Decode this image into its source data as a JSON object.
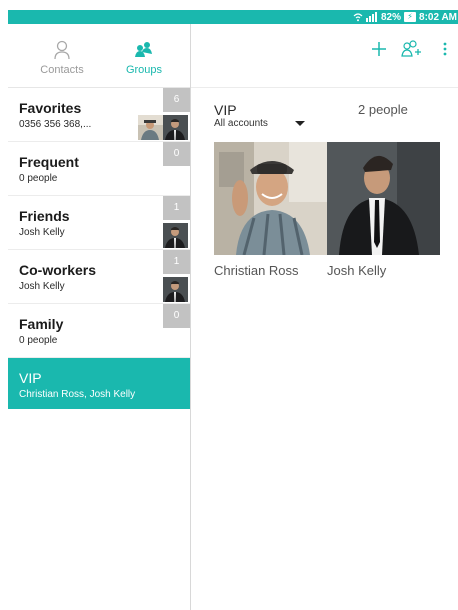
{
  "status_bar": {
    "battery": "82%",
    "time": "8:02 AM",
    "color": "#1ab8ae"
  },
  "tabs": [
    {
      "label": "Contacts",
      "icon": "person-icon",
      "active": false
    },
    {
      "label": "Groups",
      "icon": "groups-icon",
      "active": true
    }
  ],
  "groups": [
    {
      "name": "Favorites",
      "subtitle": "0356 356 368,...",
      "count": "6"
    },
    {
      "name": "Frequent",
      "subtitle": "0 people",
      "count": "0"
    },
    {
      "name": "Friends",
      "subtitle": "Josh Kelly",
      "count": "1"
    },
    {
      "name": "Co-workers",
      "subtitle": "Josh Kelly",
      "count": "1"
    },
    {
      "name": "Family",
      "subtitle": "0 people",
      "count": "0"
    },
    {
      "name": "VIP",
      "subtitle": "Christian Ross, Josh Kelly",
      "selected": true
    }
  ],
  "toolbar": {
    "actions": [
      "add-icon",
      "add-group-icon",
      "more-options-icon"
    ]
  },
  "detail": {
    "group_name": "VIP",
    "member_count": "2 people",
    "account_filter": "All accounts",
    "members": [
      "Christian Ross",
      "Josh Kelly"
    ]
  },
  "colors": {
    "accent": "#1ab8ae",
    "badge": "#c2c2c2"
  }
}
